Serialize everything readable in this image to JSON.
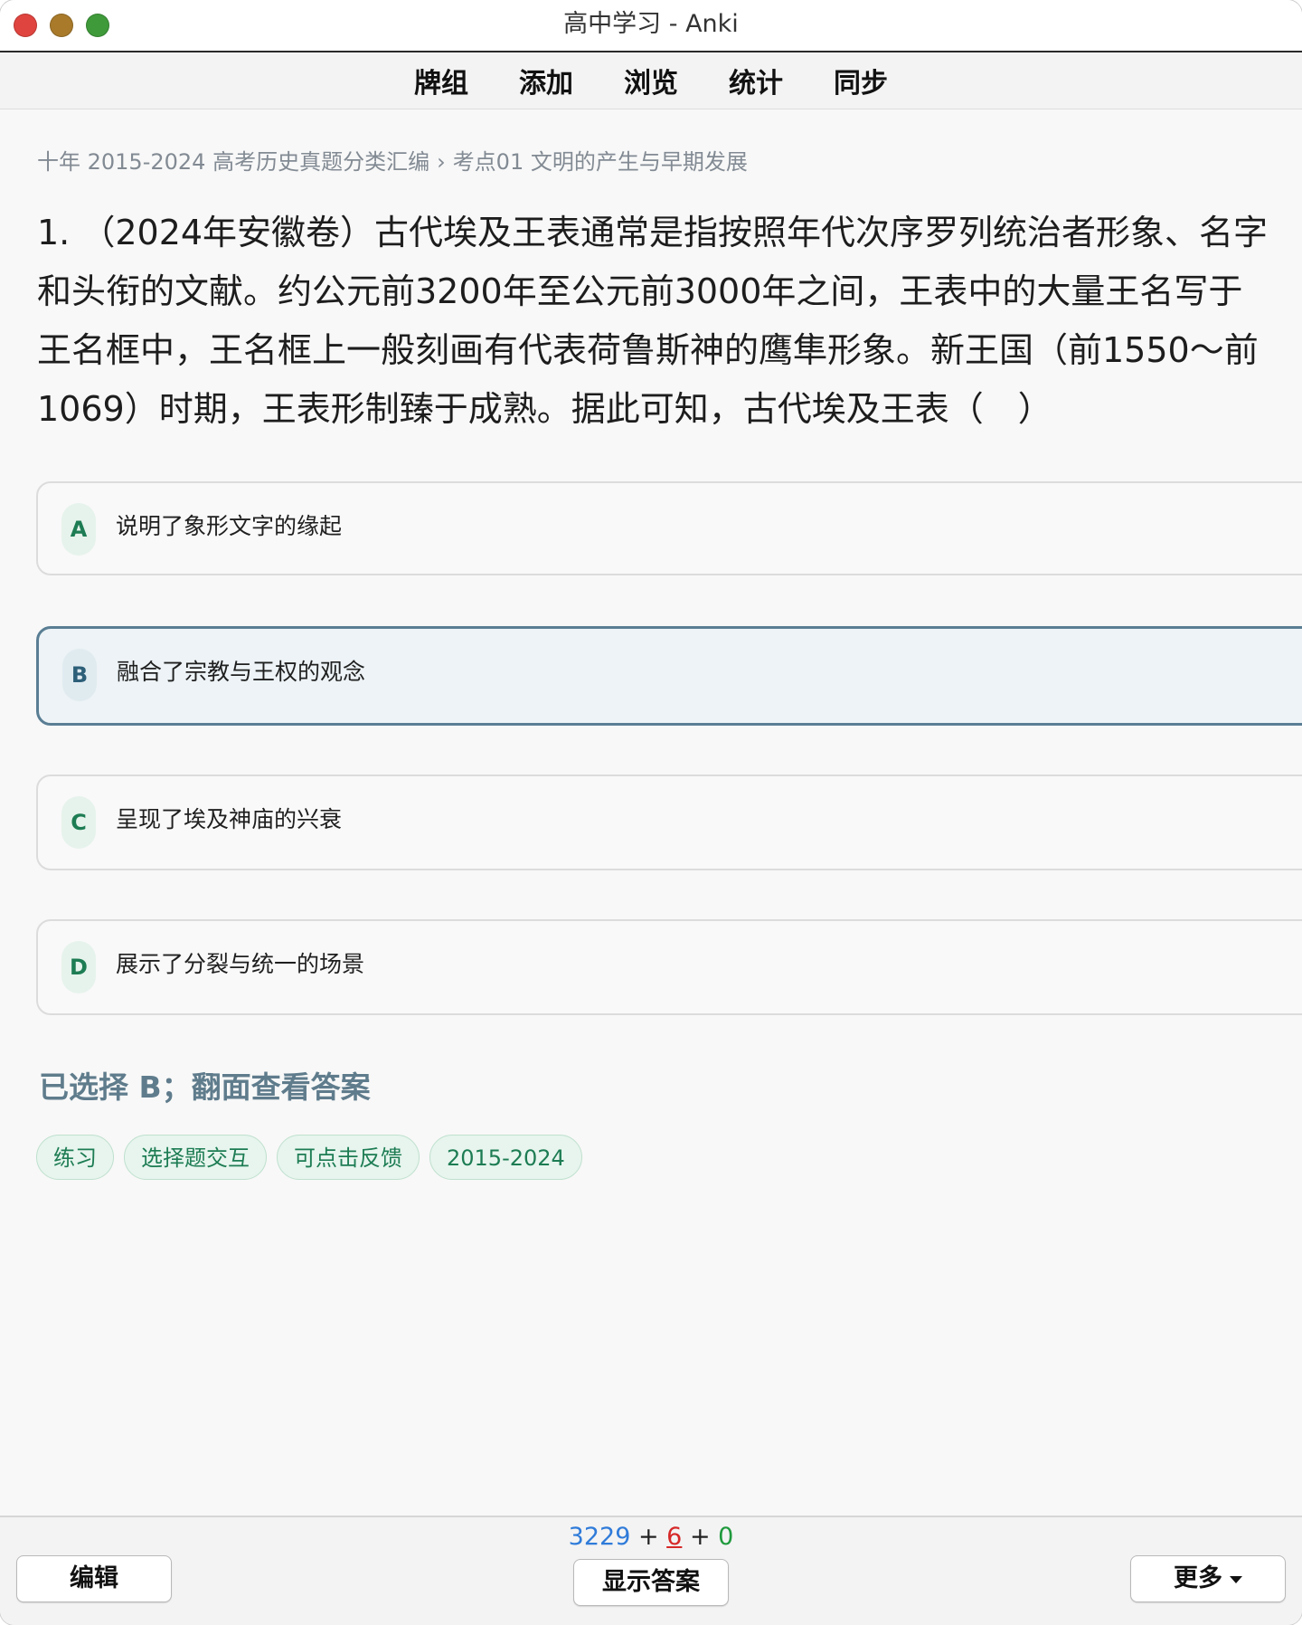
{
  "window": {
    "title": "高中学习 - Anki"
  },
  "toolbar": {
    "items": [
      "牌组",
      "添加",
      "浏览",
      "统计",
      "同步"
    ]
  },
  "breadcrumb": {
    "deck": "十年 2015-2024 高考历史真题分类汇编",
    "separator": "›",
    "subdeck": "考点01 文明的产生与早期发展"
  },
  "question": {
    "lines": [
      "1. （2024年安徽卷）古代埃及王表通常是指按照年代次序罗列统治者形象、名字",
      "和头衔的文献。约公元前3200年至公元前3000年之间，王表中的大量王名写于",
      "王名框中，王名框上一般刻画有代表荷鲁斯神的鹰隼形象。新王国（前1550～前",
      "1069）时期，王表形制臻于成熟。据此可知，古代埃及王表（　）"
    ]
  },
  "options": [
    {
      "letter": "A",
      "text": "说明了象形文字的缘起",
      "selected": false
    },
    {
      "letter": "B",
      "text": "融合了宗教与王权的观念",
      "selected": true
    },
    {
      "letter": "C",
      "text": "呈现了埃及神庙的兴衰",
      "selected": false
    },
    {
      "letter": "D",
      "text": "展示了分裂与统一的场景",
      "selected": false
    }
  ],
  "status": {
    "text": "已选择 B；翻面查看答案"
  },
  "tags": [
    "练习",
    "选择题交互",
    "可点击反馈",
    "2015-2024"
  ],
  "bottom": {
    "counts": {
      "new": "3229",
      "plus1": " + ",
      "learn": "6",
      "plus2": " + ",
      "review": "0"
    },
    "edit_label": "编辑",
    "show_answer_label": "显示答案",
    "more_label": "更多"
  },
  "colors": {
    "accent_green": "#1d7c53",
    "selected_border": "#5a7e94",
    "count_new": "#2f7bd9",
    "count_learn": "#d62828",
    "count_review": "#1f9a3d"
  }
}
